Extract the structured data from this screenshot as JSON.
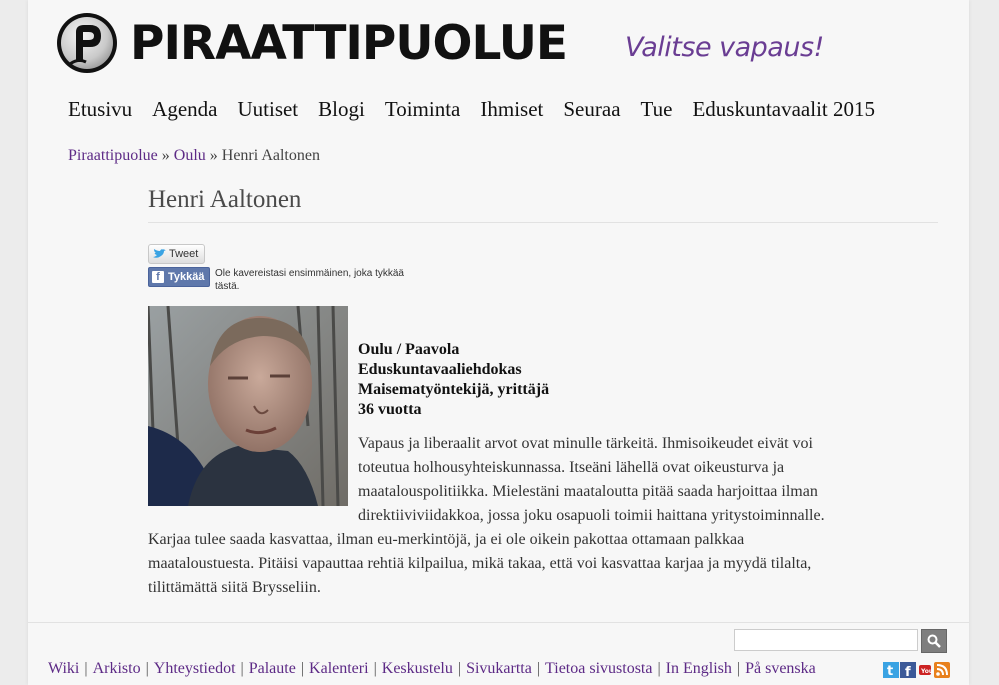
{
  "header": {
    "site_title": "PIRAATTIPUOLUE",
    "slogan": "Valitse vapaus!"
  },
  "nav": {
    "items": [
      "Etusivu",
      "Agenda",
      "Uutiset",
      "Blogi",
      "Toiminta",
      "Ihmiset",
      "Seuraa",
      "Tue",
      "Eduskuntavaalit 2015"
    ]
  },
  "breadcrumb": {
    "home": "Piraattipuolue",
    "sep": "»",
    "section": "Oulu",
    "current": "Henri Aaltonen"
  },
  "page_title": "Henri Aaltonen",
  "social": {
    "tweet": "Tweet",
    "like": "Tykkää",
    "like_text": "Ole kavereistasi ensimmäinen, joka tykkää tästä."
  },
  "profile": {
    "location": "Oulu / Paavola",
    "role": "Eduskuntavaaliehdokas",
    "occupation": "Maisematyöntekijä, yrittäjä",
    "age": "36 vuotta",
    "bio": "Vapaus ja liberaalit arvot ovat minulle tärkeitä. Ihmisoikeudet eivät voi toteutua holhousyhteiskunnassa. Itseäni lähellä ovat oikeusturva ja maatalouspolitiikka. Mielestäni maataloutta pitää saada harjoittaa ilman direktiiviviidakkoa, jossa joku osapuoli toimii haittana yritystoiminnalle. Karjaa tulee saada kasvattaa, ilman eu-merkintöjä, ja ei ole oikein pakottaa ottamaan palkkaa maataloustuesta. Pitäisi vapauttaa rehtiä kilpailua, mikä takaa, että voi kasvattaa karjaa ja myydä tilalta, tilittämättä siitä Brysseliin."
  },
  "footer": {
    "search_value": "",
    "links": [
      "Wiki",
      "Arkisto",
      "Yhteystiedot",
      "Palaute",
      "Kalenteri",
      "Keskustelu",
      "Sivukartta",
      "Tietoa sivustosta",
      "In English",
      "På svenska"
    ],
    "sep": "|",
    "icons": [
      "twitter-icon",
      "facebook-icon",
      "youtube-icon",
      "rss-icon"
    ]
  },
  "colors": {
    "link_purple": "#5d2a86",
    "slogan_purple": "#6a3d93"
  }
}
